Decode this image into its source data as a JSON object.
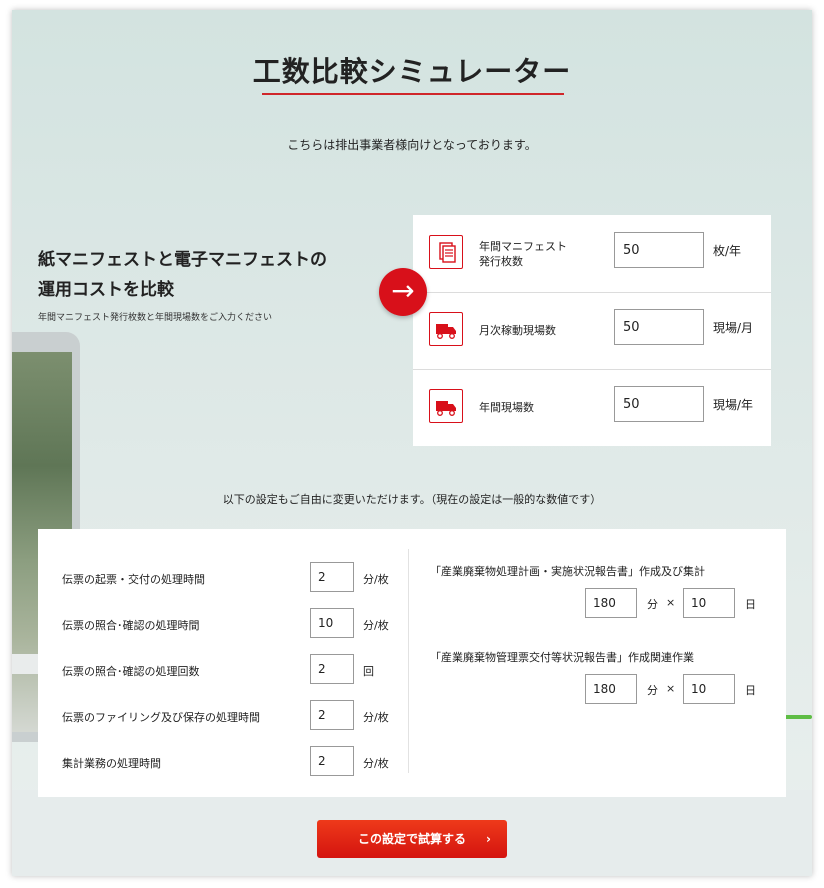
{
  "page": {
    "title": "工数比較シミュレーター",
    "subtitle": "こちらは排出事業者様向けとなっております。"
  },
  "intro": {
    "heading_line1": "紙マニフェストと電子マニフェストの",
    "heading_line2": "運用コストを比較",
    "hint": "年間マニフェスト発行枚数と年間現場数をご入力ください",
    "arrow": "→"
  },
  "inputs": [
    {
      "label_line1": "年間マニフェスト",
      "label_line2": "発行枚数",
      "value": "50",
      "unit": "枚/年",
      "icon": "document-icon"
    },
    {
      "label_line1": "月次稼動現場数",
      "label_line2": "",
      "value": "50",
      "unit": "現場/月",
      "icon": "truck-icon"
    },
    {
      "label_line1": "年間現場数",
      "label_line2": "",
      "value": "50",
      "unit": "現場/年",
      "icon": "truck-icon"
    }
  ],
  "settings_note": "以下の設定もご自由に変更いただけます。（現在の設定は一般的な数値です）",
  "settings_left": [
    {
      "label": "伝票の起票・交付の処理時間",
      "value": "2",
      "unit": "分/枚"
    },
    {
      "label": "伝票の照合･確認の処理時間",
      "value": "10",
      "unit": "分/枚"
    },
    {
      "label": "伝票の照合･確認の処理回数",
      "value": "2",
      "unit": "回"
    },
    {
      "label": "伝票のファイリング及び保存の処理時間",
      "value": "2",
      "unit": "分/枚"
    },
    {
      "label": "集計業務の処理時間",
      "value": "2",
      "unit": "分/枚"
    }
  ],
  "settings_right": [
    {
      "title": "「産業廃棄物処理計画・実施状況報告書」作成及び集計",
      "minutes": "180",
      "minutes_unit": "分",
      "times": "×",
      "days": "10",
      "days_unit": "日"
    },
    {
      "title": "「産業廃棄物管理票交付等状況報告書」作成関連作業",
      "minutes": "180",
      "minutes_unit": "分",
      "times": "×",
      "days": "10",
      "days_unit": "日"
    }
  ],
  "submit": {
    "label": "この設定で試算する",
    "chevron": "›"
  },
  "colors": {
    "accent": "#d8101a",
    "background": "#dde8e6"
  }
}
